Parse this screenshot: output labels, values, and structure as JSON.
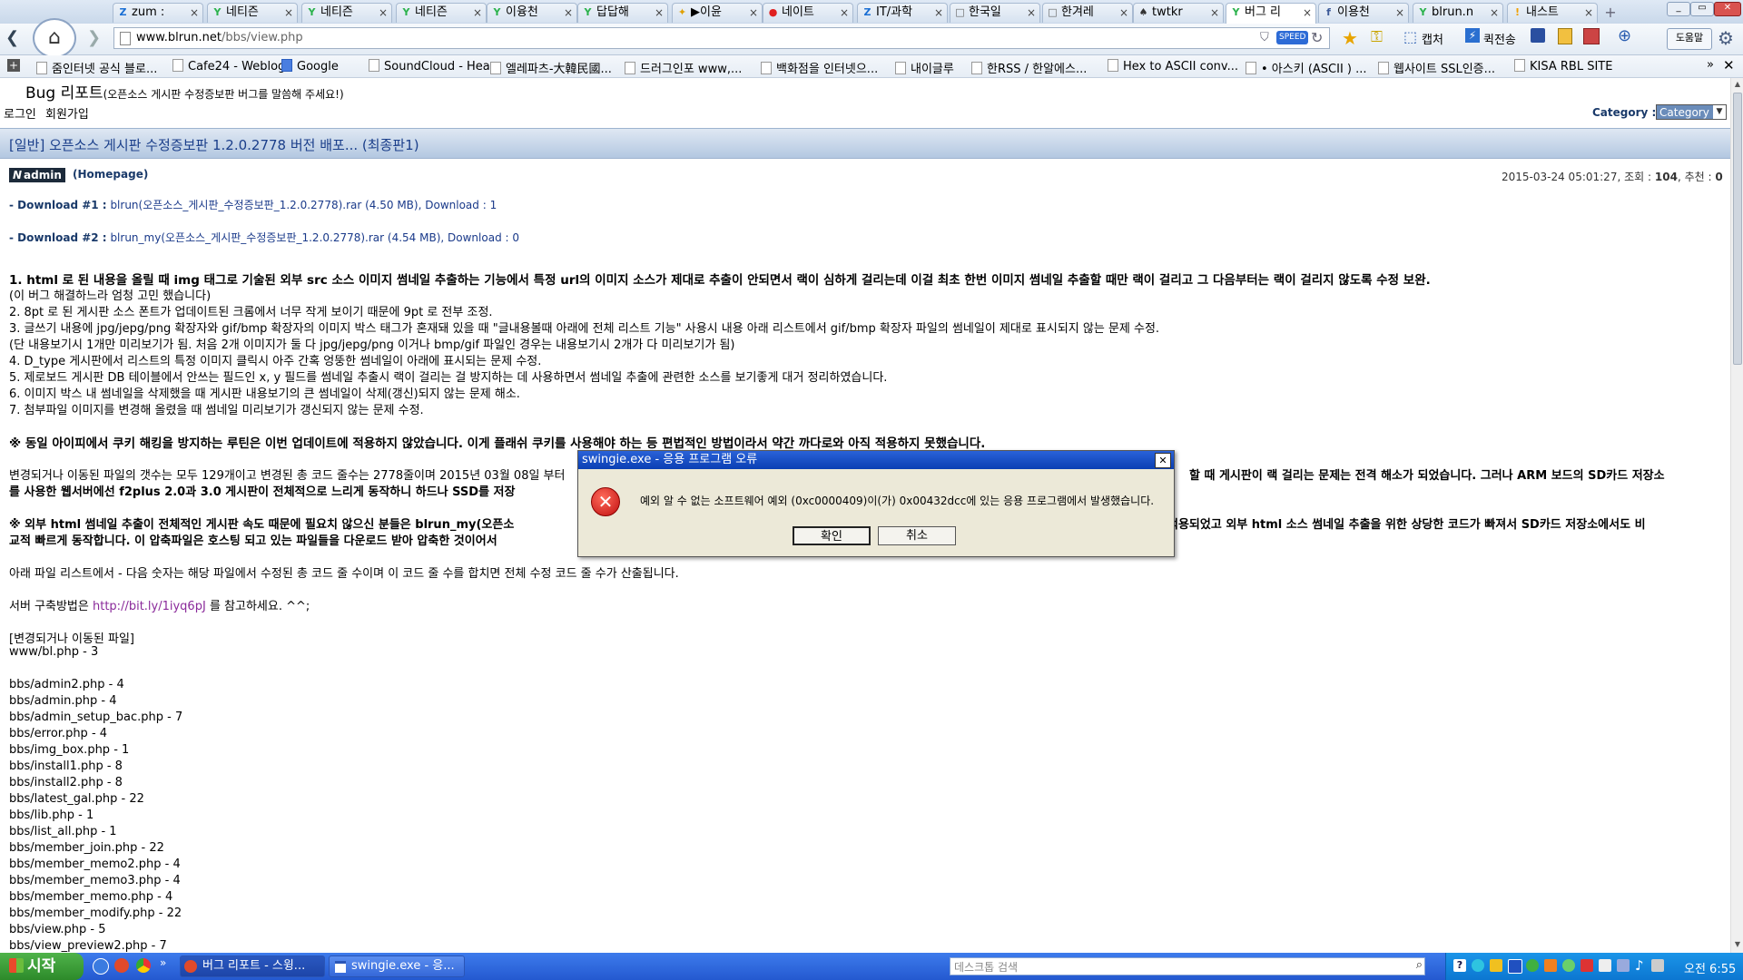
{
  "tabs": [
    {
      "label": "zum :",
      "icon": "Z",
      "color": "#1a6fd4"
    },
    {
      "label": "네티즌",
      "icon": "Y",
      "color": "#2bb24c"
    },
    {
      "label": "네티즌",
      "icon": "Y",
      "color": "#2bb24c"
    },
    {
      "label": "네티즌",
      "icon": "Y",
      "color": "#2bb24c"
    },
    {
      "label": "이융천",
      "icon": "Y",
      "color": "#2bb24c"
    },
    {
      "label": "답답해",
      "icon": "Y",
      "color": "#2bb24c"
    },
    {
      "label": "▶이윤",
      "icon": "✦",
      "color": "#e0a000"
    },
    {
      "label": "네이트",
      "icon": "●",
      "color": "#e02020"
    },
    {
      "label": "IT/과학",
      "icon": "Z",
      "color": "#1a6fd4"
    },
    {
      "label": "한국일",
      "icon": "□",
      "color": "#666666"
    },
    {
      "label": "한겨레",
      "icon": "□",
      "color": "#666666"
    },
    {
      "label": "twtkr",
      "icon": "♠",
      "color": "#333333"
    },
    {
      "label": "버그 리",
      "icon": "Y",
      "color": "#2bb24c"
    },
    {
      "label": "이용천",
      "icon": "f",
      "color": "#3b5998"
    },
    {
      "label": "blrun.n",
      "icon": "Y",
      "color": "#2bb24c"
    },
    {
      "label": "내스트",
      "icon": "!",
      "color": "#f0a000"
    }
  ],
  "nav": {
    "url_host": "www.blrun.net",
    "url_path": "/bbs/view.php",
    "speed_badge": "SPEED",
    "capture_label": "캡처",
    "translate_label": "퀵전송",
    "help_label": "도움말"
  },
  "bookmarks": [
    "줌인터넷 공식 블로...",
    "Cafe24 - Weblog",
    "Google",
    "SoundCloud - Hea...",
    "엘레파츠-大韓民國...",
    "드러그인포 www,...",
    "백화점을 인터넷으...",
    "내이글루",
    "한RSS / 한알에스...",
    "Hex to ASCII conv...",
    "• 아스키 (ASCII ) ...",
    "웹사이트 SSL인증...",
    "KISA RBL SITE"
  ],
  "board": {
    "title": "Bug 리포트",
    "subtitle": "(오픈소스 게시판 수정증보판 버그를 말씀해 주세요!)",
    "login": "로그인",
    "join": "회원가입",
    "category_label": "Category :",
    "category_value": "Category"
  },
  "post": {
    "title": "[일반] 오픈소스 게시판 수정증보판 1.2.0.2778 버전 배포... (최종판1)",
    "author": "admin",
    "author_badge": "N",
    "homepage": "(Homepage)",
    "date": "2015-03-24 05:01:27",
    "views_label": "조회 :",
    "views": "104",
    "recommend_label": "추천 :",
    "recommend": "0",
    "download1_label": "- Download #1 :",
    "download1_file": "blrun(오픈소스_게시판_수정증보판_1.2.0.2778).rar (4.50 MB),",
    "download1_count": "Download : 1",
    "download2_label": "- Download #2 :",
    "download2_file": "blrun_my(오픈소스_게시판_수정증보판_1.2.0.2778).rar (4.54 MB),",
    "download2_count": "Download : 0",
    "line1": "1. html 로 된 내용을 올릴 때 img 태그로 기술된 외부 src 소스 이미지 썸네일 추출하는 기능에서 특정 url의 이미지 소스가 제대로 추출이 안되면서 랙이 심하게 걸리는데 이걸 최초 한번 이미지 썸네일 추출할 때만 랙이 걸리고 그 다음부터는 랙이 걸리지 않도록 수정 보완.",
    "line2": "(이 버그 해결하느라 엄청 고민 했습니다)",
    "line3": "2. 8pt 로 된 게시판 소스 폰트가 업데이트된 크롬에서 너무 작게 보이기 때문에 9pt 로 전부 조정.",
    "line4": "3. 글쓰기 내용에 jpg/jepg/png 확장자와 gif/bmp 확장자의 이미지 박스 태그가 혼재돼 있을 때 \"글내용볼때 아래에 전체 리스트 기능\" 사용시 내용 아래 리스트에서 gif/bmp 확장자 파일의 썸네일이 제대로 표시되지 않는 문제 수정.",
    "line5": "(단 내용보기시 1개만 미리보기가 됨. 처음 2개 이미지가 둘 다 jpg/jepg/png 이거나 bmp/gif 파일인 경우는 내용보기시 2개가 다 미리보기가 됨)",
    "line6": "4. D_type 게시판에서 리스트의 특정 이미지 클릭시 아주 간혹 엉뚱한 썸네일이 아래에 표시되는 문제 수정.",
    "line7": "5. 제로보드 게시판 DB 테이블에서 안쓰는 필드인 x, y 필드를 썸네일 추출시 랙이 걸리는 걸 방지하는 데 사용하면서 썸네일 추출에 관련한 소스를 보기좋게 대거 정리하였습니다.",
    "line8": "6. 이미지 박스 내 썸네일을 삭제했을 때 게시판 내용보기의 큰 썸네일이 삭제(갱신)되지 않는 문제 해소.",
    "line9": "7. 첨부파일 이미지를 변경해 올렸을 때 썸네일 미리보기가 갱신되지 않는 문제 수정.",
    "notice1": "※ 동일 아이피에서 쿠키 해킹을 방지하는 루틴은 이번 업데이트에 적용하지 않았습니다. 이게 플래쉬 쿠키를 사용해야 하는 등 편법적인 방법이라서 약간 까다로와 아직 적용하지 못했습니다.",
    "para2_a": "변경되거나 이동된 파일의 갯수는 모두 129개이고 변경된 총 코드 줄수는 2778줄이며 2015년 03월 08일 부터",
    "para2_b": "할 때 게시판이 랙 걸리는 문제는 전격 해소가 되었습니다. 그러나 ARM 보드의 SD카드 저장소",
    "para2_c": "를 사용한 웹서버에선 f2plus 2.0과 3.0 게시판이 전체적으로 느리게 동작하니 하드나 SSD를 저장",
    "notice2_a": "※ 외부 html 썸네일 추출이 전체적인 게시판 속도 때문에 필요치 않으신 분들은 blrun_my(오픈소",
    "notice2_b": "적용되었고 외부 html 소스 썸네일 추출을 위한 상당한 코드가 빠져서 SD카드 저장소에서도 비",
    "notice2_c": "교적 빠르게 동작합니다. 이 압축파일은 호스팅 되고 있는 파일들을 다운로드 받아 압축한 것이어서",
    "para3": "아래 파일 리스트에서 - 다음 숫자는 해당 파일에서 수정된 총 코드 줄 수이며 이 코드 줄 수를 합치면 전체 수정 코드 줄 수가 산출됩니다.",
    "server_label": "서버 구축방법은",
    "server_link": "http://bit.ly/1iyq6pJ",
    "server_tail": "를 참고하세요. ^^;",
    "files_header": "[변경되거나 이동된 파일]",
    "file_root": "www/bl.php - 3",
    "files": [
      "bbs/admin2.php - 4",
      "bbs/admin.php - 4",
      "bbs/admin_setup_bac.php - 7",
      "bbs/error.php - 4",
      "bbs/img_box.php - 1",
      "bbs/install1.php - 8",
      "bbs/install2.php - 8",
      "bbs/latest_gal.php - 22",
      "bbs/lib.php - 1",
      "bbs/list_all.php - 1",
      "bbs/member_join.php - 22",
      "bbs/member_memo2.php - 4",
      "bbs/member_memo3.php - 4",
      "bbs/member_memo.php - 4",
      "bbs/member_modify.php - 22",
      "bbs/view.php - 5",
      "bbs/view_preview2.php - 7"
    ]
  },
  "dialog": {
    "title": "swingie.exe - 응용 프로그램 오류",
    "message": "예외 알 수 없는 소프트웨어 예외 (0xc0000409)이(가) 0x00432dcc에 있는 응용 프로그램에서 발생했습니다.",
    "ok": "확인",
    "cancel": "취소",
    "close": "✕"
  },
  "taskbar": {
    "start": "시작",
    "task1": "버그 리포트 - 스윙...",
    "task2": "swingie.exe - 응...",
    "search_placeholder": "데스크톱 검색",
    "clock": "오전 6:55"
  }
}
